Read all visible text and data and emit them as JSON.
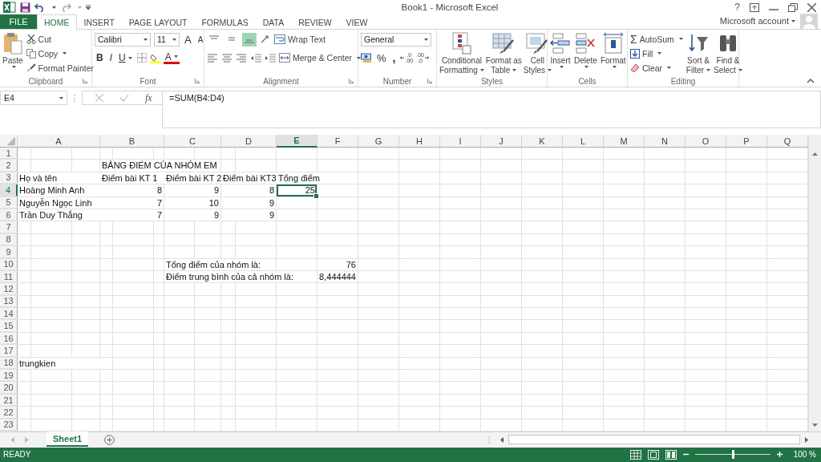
{
  "window": {
    "title": "Book1 - Microsoft Excel",
    "help": "?"
  },
  "ribbon_tabs": {
    "file": "FILE",
    "tabs": [
      {
        "label": "HOME",
        "selected": true
      },
      {
        "label": "INSERT",
        "selected": false
      },
      {
        "label": "PAGE LAYOUT",
        "selected": false
      },
      {
        "label": "FORMULAS",
        "selected": false
      },
      {
        "label": "DATA",
        "selected": false
      },
      {
        "label": "REVIEW",
        "selected": false
      },
      {
        "label": "VIEW",
        "selected": false
      }
    ]
  },
  "account": {
    "label": "Microsoft account"
  },
  "ribbon": {
    "clipboard": {
      "label": "Clipboard",
      "launcher": true,
      "paste": "Paste",
      "cut": "Cut",
      "copy": "Copy",
      "format_painter": "Format Painter"
    },
    "font": {
      "label": "Font",
      "launcher": true,
      "name": "Calibri",
      "size": "11",
      "grow": "A",
      "shrink": "A",
      "bold": "B",
      "italic": "I",
      "underline": "U",
      "color_letter": "A"
    },
    "alignment": {
      "label": "Alignment",
      "launcher": true,
      "vertical": [
        {
          "selected": false
        },
        {
          "selected": false
        },
        {
          "selected": true
        }
      ],
      "wrap": "Wrap Text",
      "merge": "Merge & Center"
    },
    "number": {
      "label": "Number",
      "launcher": true,
      "format": "General",
      "percent": "%",
      "comma": ",",
      "increase_decimal": [
        ".0",
        ".00"
      ],
      "decrease_decimal": [
        ".00",
        ".0"
      ]
    },
    "styles": {
      "label": "Styles",
      "buttons": [
        {
          "kind": "conditional",
          "lines": [
            "Conditional",
            "Formatting"
          ]
        },
        {
          "kind": "table",
          "lines": [
            "Format as",
            "Table"
          ]
        },
        {
          "kind": "cell_styles",
          "lines": [
            "Cell",
            "Styles"
          ]
        }
      ]
    },
    "cells": {
      "label": "Cells",
      "buttons": [
        {
          "kind": "insert",
          "label": "Insert"
        },
        {
          "kind": "delete",
          "label": "Delete"
        },
        {
          "kind": "format",
          "label": "Format"
        }
      ]
    },
    "editing": {
      "label": "Editing",
      "autosum_symbol": "Σ",
      "autosum": "AutoSum",
      "fill": "Fill",
      "clear": "Clear",
      "sort": [
        "Sort &",
        "Filter"
      ],
      "find": [
        "Find &",
        "Select"
      ]
    }
  },
  "formula_bar": {
    "name_box": "E4",
    "fx": "fx",
    "formula": "=SUM(B4:D4)"
  },
  "columns": [
    {
      "label": "A",
      "selected": false
    },
    {
      "label": "B",
      "selected": false
    },
    {
      "label": "C",
      "selected": false
    },
    {
      "label": "D",
      "selected": false
    },
    {
      "label": "E",
      "selected": true
    },
    {
      "label": "F",
      "selected": false
    },
    {
      "label": "G",
      "selected": false
    },
    {
      "label": "H",
      "selected": false
    },
    {
      "label": "I",
      "selected": false
    },
    {
      "label": "J",
      "selected": false
    },
    {
      "label": "K",
      "selected": false
    },
    {
      "label": "L",
      "selected": false
    },
    {
      "label": "M",
      "selected": false
    },
    {
      "label": "N",
      "selected": false
    },
    {
      "label": "O",
      "selected": false
    },
    {
      "label": "P",
      "selected": false
    },
    {
      "label": "Q",
      "selected": false
    }
  ],
  "rows": [
    {
      "number": "1",
      "selected": false
    },
    {
      "number": "2",
      "selected": false,
      "cells": [
        {
          "kind": "empty"
        },
        {
          "value": "BẢNG ĐIỂM CỦA NHÓM EM",
          "kind": "text",
          "selected": false
        }
      ]
    },
    {
      "number": "3",
      "selected": false,
      "cells": [
        {
          "value": "Họ và tên",
          "kind": "text",
          "selected": false
        },
        {
          "value": "Điểm bài KT 1",
          "kind": "text",
          "selected": false
        },
        {
          "value": "Điểm bài KT 2",
          "kind": "text",
          "selected": false
        },
        {
          "value": "Điểm bài KT3",
          "kind": "text",
          "selected": false
        },
        {
          "value": "Tổng điểm",
          "kind": "text",
          "selected": false
        }
      ]
    },
    {
      "number": "4",
      "selected": true,
      "cells": [
        {
          "value": "Hoàng Minh Anh",
          "kind": "text",
          "selected": false
        },
        {
          "value": "8",
          "kind": "number",
          "selected": false
        },
        {
          "value": "9",
          "kind": "number",
          "selected": false
        },
        {
          "value": "8",
          "kind": "number",
          "selected": false
        },
        {
          "value": "25",
          "kind": "number",
          "selected": true
        }
      ]
    },
    {
      "number": "5",
      "selected": false,
      "cells": [
        {
          "value": "Nguyễn Ngọc Linh",
          "kind": "text",
          "selected": false
        },
        {
          "value": "7",
          "kind": "number",
          "selected": false
        },
        {
          "value": "10",
          "kind": "number",
          "selected": false
        },
        {
          "value": "9",
          "kind": "number",
          "selected": false
        }
      ]
    },
    {
      "number": "6",
      "selected": false,
      "cells": [
        {
          "value": "Trần Duy Thắng",
          "kind": "text",
          "selected": false
        },
        {
          "value": "7",
          "kind": "number",
          "selected": false
        },
        {
          "value": "9",
          "kind": "number",
          "selected": false
        },
        {
          "value": "9",
          "kind": "number",
          "selected": false
        }
      ]
    },
    {
      "number": "7",
      "selected": false
    },
    {
      "number": "8",
      "selected": false
    },
    {
      "number": "9",
      "selected": false
    },
    {
      "number": "10",
      "selected": false,
      "cells": [
        {
          "kind": "empty"
        },
        {
          "kind": "empty"
        },
        {
          "value": "Tổng điểm của nhóm là:",
          "kind": "text",
          "selected": false
        },
        {
          "kind": "empty"
        },
        {
          "kind": "empty"
        },
        {
          "value": "76",
          "kind": "number",
          "selected": false
        }
      ]
    },
    {
      "number": "11",
      "selected": false,
      "cells": [
        {
          "kind": "empty"
        },
        {
          "kind": "empty"
        },
        {
          "value": "Điểm trung bình của cả nhóm là:",
          "kind": "text",
          "selected": false
        },
        {
          "kind": "empty"
        },
        {
          "kind": "empty"
        },
        {
          "value": "8,444444",
          "kind": "number",
          "selected": false
        }
      ]
    },
    {
      "number": "12",
      "selected": false
    },
    {
      "number": "13",
      "selected": false
    },
    {
      "number": "14",
      "selected": false
    },
    {
      "number": "15",
      "selected": false
    },
    {
      "number": "16",
      "selected": false
    },
    {
      "number": "17",
      "selected": false
    },
    {
      "number": "18",
      "selected": false,
      "cells": [
        {
          "value": "trungkien",
          "kind": "text",
          "selected": false
        }
      ]
    },
    {
      "number": "19",
      "selected": false
    },
    {
      "number": "20",
      "selected": false
    },
    {
      "number": "21",
      "selected": false
    },
    {
      "number": "22",
      "selected": false
    },
    {
      "number": "23",
      "selected": false
    }
  ],
  "sheet_tabs": [
    {
      "name": "Sheet1",
      "selected": true
    }
  ],
  "status_bar": {
    "mode": "READY",
    "zoom": {
      "level": 0.5
    },
    "zoom_label": "100 %"
  }
}
